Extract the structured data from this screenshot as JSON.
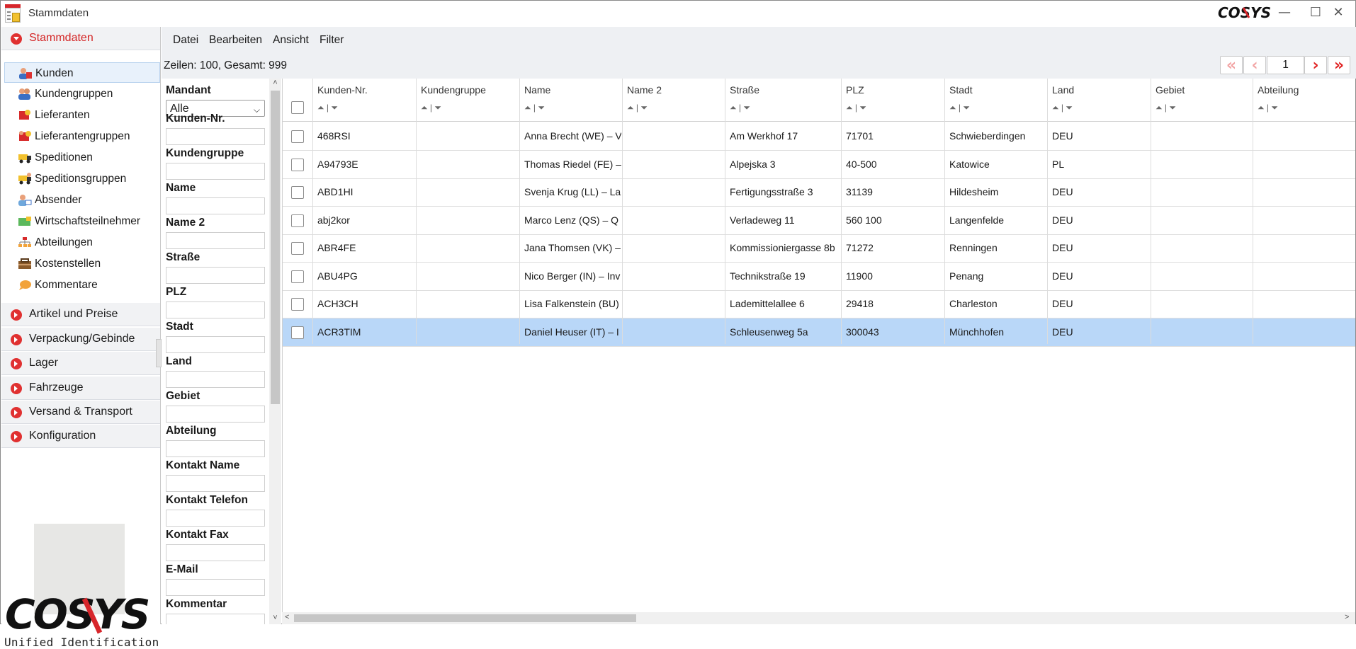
{
  "window": {
    "title": "Stammdaten",
    "brand": "COSYS",
    "min_icon": "minimize-icon",
    "max_icon": "maximize-icon",
    "close_icon": "close-icon"
  },
  "sidebar": {
    "open_section": "Stammdaten",
    "items": [
      {
        "label": "Kunden",
        "icon": "customers-icon",
        "active": true
      },
      {
        "label": "Kundengruppen",
        "icon": "customer-groups-icon"
      },
      {
        "label": "Lieferanten",
        "icon": "suppliers-icon"
      },
      {
        "label": "Lieferantengruppen",
        "icon": "supplier-groups-icon"
      },
      {
        "label": "Speditionen",
        "icon": "truck-icon"
      },
      {
        "label": "Speditionsgruppen",
        "icon": "truck-groups-icon"
      },
      {
        "label": "Absender",
        "icon": "sender-icon"
      },
      {
        "label": "Wirtschaftsteilnehmer",
        "icon": "economic-operator-icon"
      },
      {
        "label": "Abteilungen",
        "icon": "departments-icon"
      },
      {
        "label": "Kostenstellen",
        "icon": "cost-center-icon"
      },
      {
        "label": "Kommentare",
        "icon": "comments-icon"
      }
    ],
    "sections": [
      {
        "label": "Artikel und Preise"
      },
      {
        "label": "Verpackung/Gebinde"
      },
      {
        "label": "Lager"
      },
      {
        "label": "Fahrzeuge"
      },
      {
        "label": "Versand & Transport"
      },
      {
        "label": "Konfiguration"
      }
    ],
    "logo_subtitle": "Unified Identification"
  },
  "menu": {
    "datei": "Datei",
    "bearbeiten": "Bearbeiten",
    "ansicht": "Ansicht",
    "filter": "Filter"
  },
  "info": {
    "rows_text": "Zeilen: 100, Gesamt: 999"
  },
  "pager": {
    "page": "1",
    "first_icon": "first-page-icon",
    "prev_icon": "prev-page-icon",
    "next_icon": "next-page-icon",
    "last_icon": "last-page-icon"
  },
  "filters": {
    "mandant_label": "Mandant",
    "mandant_value": "Alle",
    "fields": [
      "Kunden-Nr.",
      "Kundengruppe",
      "Name",
      "Name 2",
      "Straße",
      "PLZ",
      "Stadt",
      "Land",
      "Gebiet",
      "Abteilung",
      "Kontakt Name",
      "Kontakt Telefon",
      "Kontakt Fax",
      "E-Mail",
      "Kommentar"
    ]
  },
  "table": {
    "columns": [
      "Kunden-Nr.",
      "Kundengruppe",
      "Name",
      "Name 2",
      "Straße",
      "PLZ",
      "Stadt",
      "Land",
      "Gebiet",
      "Abteilung"
    ],
    "sort_text": "⏶ | ⏷",
    "rows": [
      {
        "id": "468RSI",
        "group": "",
        "name": "Anna Brecht (WE) – V",
        "name2": "",
        "street": "Am Werkhof 17",
        "plz": "71701",
        "city": "Schwieberdingen",
        "country": "DEU",
        "area": "",
        "dept": ""
      },
      {
        "id": "A94793E",
        "group": "",
        "name": "Thomas Riedel (FE) –",
        "name2": "",
        "street": "Alpejska 3",
        "plz": "40-500",
        "city": "Katowice",
        "country": "PL",
        "area": "",
        "dept": ""
      },
      {
        "id": "ABD1HI",
        "group": "",
        "name": "Svenja Krug (LL) – La",
        "name2": "",
        "street": "Fertigungsstraße 3",
        "plz": "31139",
        "city": "Hildesheim",
        "country": "DEU",
        "area": "",
        "dept": ""
      },
      {
        "id": "abj2kor",
        "group": "",
        "name": "Marco Lenz (QS) – Q",
        "name2": "",
        "street": "Verladeweg 11",
        "plz": "560 100",
        "city": "Langenfelde",
        "country": "DEU",
        "area": "",
        "dept": ""
      },
      {
        "id": "ABR4FE",
        "group": "",
        "name": "Jana Thomsen (VK) –",
        "name2": "",
        "street": "Kommissioniergasse 8b",
        "plz": "71272",
        "city": "Renningen",
        "country": "DEU",
        "area": "",
        "dept": ""
      },
      {
        "id": "ABU4PG",
        "group": "",
        "name": "Nico Berger (IN) – Inv",
        "name2": "",
        "street": "Technikstraße 19",
        "plz": "11900",
        "city": "Penang",
        "country": "DEU",
        "area": "",
        "dept": ""
      },
      {
        "id": "ACH3CH",
        "group": "",
        "name": "Lisa Falkenstein (BU)",
        "name2": "",
        "street": "Lademittelallee 6",
        "plz": "29418",
        "city": "Charleston",
        "country": "DEU",
        "area": "",
        "dept": ""
      },
      {
        "id": "ACR3TIM",
        "group": "",
        "name": "Daniel Heuser (IT) – I",
        "name2": "",
        "street": "Schleusenweg 5a",
        "plz": "300043",
        "city": "Münchhofen",
        "country": "DEU",
        "area": "",
        "dept": "",
        "selected": true
      }
    ]
  },
  "colors": {
    "accent_red": "#e03131",
    "selected_row": "#b9d7f8",
    "toolbar_bg": "#eef0f3"
  }
}
